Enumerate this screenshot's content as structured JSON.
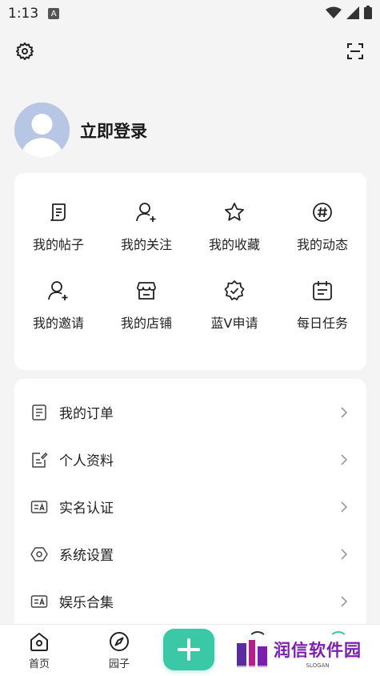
{
  "status": {
    "time": "1:13",
    "a_icon": "A"
  },
  "profile": {
    "login_label": "立即登录"
  },
  "grid": {
    "items": [
      {
        "label": "我的帖子",
        "icon": "posts-icon"
      },
      {
        "label": "我的关注",
        "icon": "follow-icon"
      },
      {
        "label": "我的收藏",
        "icon": "star-icon"
      },
      {
        "label": "我的动态",
        "icon": "hashtag-icon"
      },
      {
        "label": "我的邀请",
        "icon": "invite-icon"
      },
      {
        "label": "我的店铺",
        "icon": "store-icon"
      },
      {
        "label": "蓝V申请",
        "icon": "verified-badge-icon"
      },
      {
        "label": "每日任务",
        "icon": "calendar-icon"
      }
    ]
  },
  "list": {
    "items": [
      {
        "label": "我的订单",
        "icon": "order-icon"
      },
      {
        "label": "个人资料",
        "icon": "edit-profile-icon"
      },
      {
        "label": "实名认证",
        "icon": "id-card-icon"
      },
      {
        "label": "系统设置",
        "icon": "hexagon-settings-icon"
      },
      {
        "label": "娱乐合集",
        "icon": "entertainment-icon"
      }
    ]
  },
  "nav": {
    "home": "首页",
    "garden": "园子"
  },
  "watermark": {
    "title": "润信软件园",
    "slogan": "SLOGAN"
  },
  "colors": {
    "accent": "#3bc8a7",
    "background": "#f4f4f4",
    "watermark": "#7a1fb0"
  }
}
